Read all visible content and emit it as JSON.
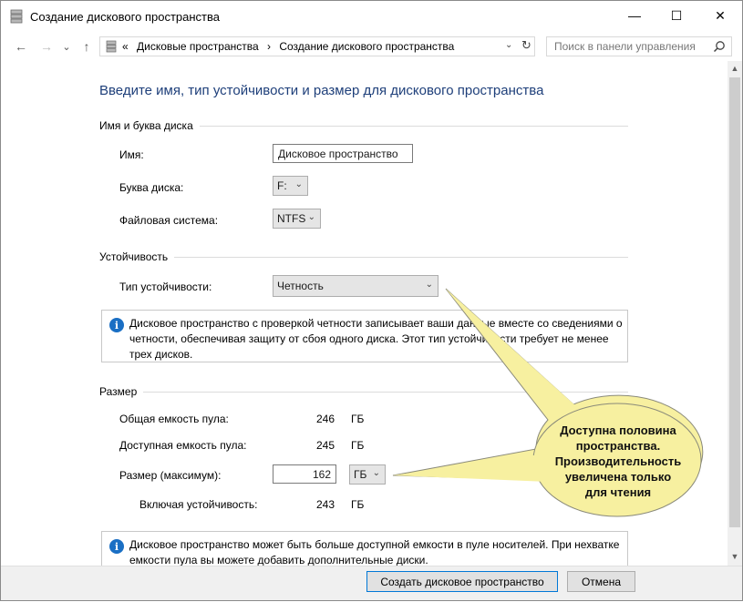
{
  "window": {
    "title": "Создание дискового пространства",
    "minimize": "—",
    "maximize": "☐",
    "close": "✕"
  },
  "nav": {
    "back": "←",
    "forward": "→",
    "recent": "⌄",
    "up": "↑",
    "breadcrumb": [
      "«",
      "Дисковые пространства",
      "›",
      "Создание дискового пространства"
    ],
    "dropdown": "⌄",
    "refresh": "↻",
    "search_placeholder": "Поиск в панели управления"
  },
  "main": {
    "heading": "Введите имя, тип устойчивости и размер для дискового пространства",
    "name_section": {
      "title": "Имя и буква диска",
      "name_label": "Имя:",
      "name_value": "Дисковое пространство",
      "letter_label": "Буква диска:",
      "letter_value": "F:",
      "fs_label": "Файловая система:",
      "fs_value": "NTFS"
    },
    "resiliency_section": {
      "title": "Устойчивость",
      "type_label": "Тип устойчивости:",
      "type_value": "Четность",
      "info_text": "Дисковое пространство с проверкой четности записывает ваши данные вместе со сведениями о четности, обеспечивая защиту от сбоя одного диска. Этот тип устойчивости требует не менее трех дисков."
    },
    "size_section": {
      "title": "Размер",
      "total_label": "Общая емкость пула:",
      "total_value": "246",
      "total_unit": "ГБ",
      "available_label": "Доступная емкость пула:",
      "available_value": "245",
      "available_unit": "ГБ",
      "size_label": "Размер (максимум):",
      "size_value": "162",
      "size_unit": "ГБ",
      "including_label": "Включая устойчивость:",
      "including_value": "243",
      "including_unit": "ГБ",
      "info_text": "Дисковое пространство может быть больше доступной емкости в пуле носителей. При нехватке емкости пула вы можете добавить дополнительные диски."
    }
  },
  "callout": {
    "lines": [
      "Доступна половина",
      "пространства.",
      "Производительность",
      "увеличена только",
      "для чтения"
    ]
  },
  "footer": {
    "create_button": "Создать дисковое пространство",
    "cancel_button": "Отмена"
  },
  "colors": {
    "heading": "#1e3f7a",
    "info_icon": "#1a6fc4",
    "callout_fill": "#f7f0a0",
    "primary_border": "#0078d7"
  }
}
